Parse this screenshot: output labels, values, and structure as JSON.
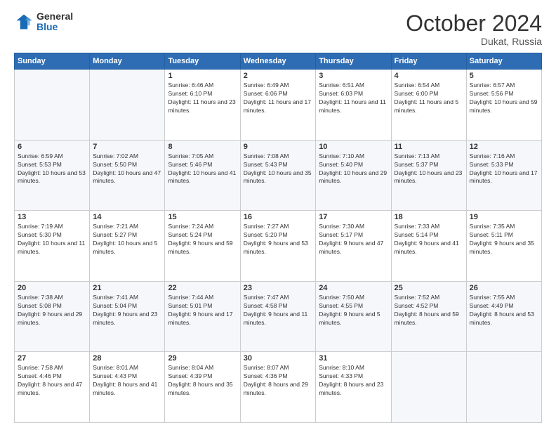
{
  "logo": {
    "general": "General",
    "blue": "Blue"
  },
  "title": {
    "month_year": "October 2024",
    "location": "Dukat, Russia"
  },
  "headers": [
    "Sunday",
    "Monday",
    "Tuesday",
    "Wednesday",
    "Thursday",
    "Friday",
    "Saturday"
  ],
  "weeks": [
    [
      {
        "day": "",
        "sunrise": "",
        "sunset": "",
        "daylight": ""
      },
      {
        "day": "",
        "sunrise": "",
        "sunset": "",
        "daylight": ""
      },
      {
        "day": "1",
        "sunrise": "Sunrise: 6:46 AM",
        "sunset": "Sunset: 6:10 PM",
        "daylight": "Daylight: 11 hours and 23 minutes."
      },
      {
        "day": "2",
        "sunrise": "Sunrise: 6:49 AM",
        "sunset": "Sunset: 6:06 PM",
        "daylight": "Daylight: 11 hours and 17 minutes."
      },
      {
        "day": "3",
        "sunrise": "Sunrise: 6:51 AM",
        "sunset": "Sunset: 6:03 PM",
        "daylight": "Daylight: 11 hours and 11 minutes."
      },
      {
        "day": "4",
        "sunrise": "Sunrise: 6:54 AM",
        "sunset": "Sunset: 6:00 PM",
        "daylight": "Daylight: 11 hours and 5 minutes."
      },
      {
        "day": "5",
        "sunrise": "Sunrise: 6:57 AM",
        "sunset": "Sunset: 5:56 PM",
        "daylight": "Daylight: 10 hours and 59 minutes."
      }
    ],
    [
      {
        "day": "6",
        "sunrise": "Sunrise: 6:59 AM",
        "sunset": "Sunset: 5:53 PM",
        "daylight": "Daylight: 10 hours and 53 minutes."
      },
      {
        "day": "7",
        "sunrise": "Sunrise: 7:02 AM",
        "sunset": "Sunset: 5:50 PM",
        "daylight": "Daylight: 10 hours and 47 minutes."
      },
      {
        "day": "8",
        "sunrise": "Sunrise: 7:05 AM",
        "sunset": "Sunset: 5:46 PM",
        "daylight": "Daylight: 10 hours and 41 minutes."
      },
      {
        "day": "9",
        "sunrise": "Sunrise: 7:08 AM",
        "sunset": "Sunset: 5:43 PM",
        "daylight": "Daylight: 10 hours and 35 minutes."
      },
      {
        "day": "10",
        "sunrise": "Sunrise: 7:10 AM",
        "sunset": "Sunset: 5:40 PM",
        "daylight": "Daylight: 10 hours and 29 minutes."
      },
      {
        "day": "11",
        "sunrise": "Sunrise: 7:13 AM",
        "sunset": "Sunset: 5:37 PM",
        "daylight": "Daylight: 10 hours and 23 minutes."
      },
      {
        "day": "12",
        "sunrise": "Sunrise: 7:16 AM",
        "sunset": "Sunset: 5:33 PM",
        "daylight": "Daylight: 10 hours and 17 minutes."
      }
    ],
    [
      {
        "day": "13",
        "sunrise": "Sunrise: 7:19 AM",
        "sunset": "Sunset: 5:30 PM",
        "daylight": "Daylight: 10 hours and 11 minutes."
      },
      {
        "day": "14",
        "sunrise": "Sunrise: 7:21 AM",
        "sunset": "Sunset: 5:27 PM",
        "daylight": "Daylight: 10 hours and 5 minutes."
      },
      {
        "day": "15",
        "sunrise": "Sunrise: 7:24 AM",
        "sunset": "Sunset: 5:24 PM",
        "daylight": "Daylight: 9 hours and 59 minutes."
      },
      {
        "day": "16",
        "sunrise": "Sunrise: 7:27 AM",
        "sunset": "Sunset: 5:20 PM",
        "daylight": "Daylight: 9 hours and 53 minutes."
      },
      {
        "day": "17",
        "sunrise": "Sunrise: 7:30 AM",
        "sunset": "Sunset: 5:17 PM",
        "daylight": "Daylight: 9 hours and 47 minutes."
      },
      {
        "day": "18",
        "sunrise": "Sunrise: 7:33 AM",
        "sunset": "Sunset: 5:14 PM",
        "daylight": "Daylight: 9 hours and 41 minutes."
      },
      {
        "day": "19",
        "sunrise": "Sunrise: 7:35 AM",
        "sunset": "Sunset: 5:11 PM",
        "daylight": "Daylight: 9 hours and 35 minutes."
      }
    ],
    [
      {
        "day": "20",
        "sunrise": "Sunrise: 7:38 AM",
        "sunset": "Sunset: 5:08 PM",
        "daylight": "Daylight: 9 hours and 29 minutes."
      },
      {
        "day": "21",
        "sunrise": "Sunrise: 7:41 AM",
        "sunset": "Sunset: 5:04 PM",
        "daylight": "Daylight: 9 hours and 23 minutes."
      },
      {
        "day": "22",
        "sunrise": "Sunrise: 7:44 AM",
        "sunset": "Sunset: 5:01 PM",
        "daylight": "Daylight: 9 hours and 17 minutes."
      },
      {
        "day": "23",
        "sunrise": "Sunrise: 7:47 AM",
        "sunset": "Sunset: 4:58 PM",
        "daylight": "Daylight: 9 hours and 11 minutes."
      },
      {
        "day": "24",
        "sunrise": "Sunrise: 7:50 AM",
        "sunset": "Sunset: 4:55 PM",
        "daylight": "Daylight: 9 hours and 5 minutes."
      },
      {
        "day": "25",
        "sunrise": "Sunrise: 7:52 AM",
        "sunset": "Sunset: 4:52 PM",
        "daylight": "Daylight: 8 hours and 59 minutes."
      },
      {
        "day": "26",
        "sunrise": "Sunrise: 7:55 AM",
        "sunset": "Sunset: 4:49 PM",
        "daylight": "Daylight: 8 hours and 53 minutes."
      }
    ],
    [
      {
        "day": "27",
        "sunrise": "Sunrise: 7:58 AM",
        "sunset": "Sunset: 4:46 PM",
        "daylight": "Daylight: 8 hours and 47 minutes."
      },
      {
        "day": "28",
        "sunrise": "Sunrise: 8:01 AM",
        "sunset": "Sunset: 4:43 PM",
        "daylight": "Daylight: 8 hours and 41 minutes."
      },
      {
        "day": "29",
        "sunrise": "Sunrise: 8:04 AM",
        "sunset": "Sunset: 4:39 PM",
        "daylight": "Daylight: 8 hours and 35 minutes."
      },
      {
        "day": "30",
        "sunrise": "Sunrise: 8:07 AM",
        "sunset": "Sunset: 4:36 PM",
        "daylight": "Daylight: 8 hours and 29 minutes."
      },
      {
        "day": "31",
        "sunrise": "Sunrise: 8:10 AM",
        "sunset": "Sunset: 4:33 PM",
        "daylight": "Daylight: 8 hours and 23 minutes."
      },
      {
        "day": "",
        "sunrise": "",
        "sunset": "",
        "daylight": ""
      },
      {
        "day": "",
        "sunrise": "",
        "sunset": "",
        "daylight": ""
      }
    ]
  ]
}
